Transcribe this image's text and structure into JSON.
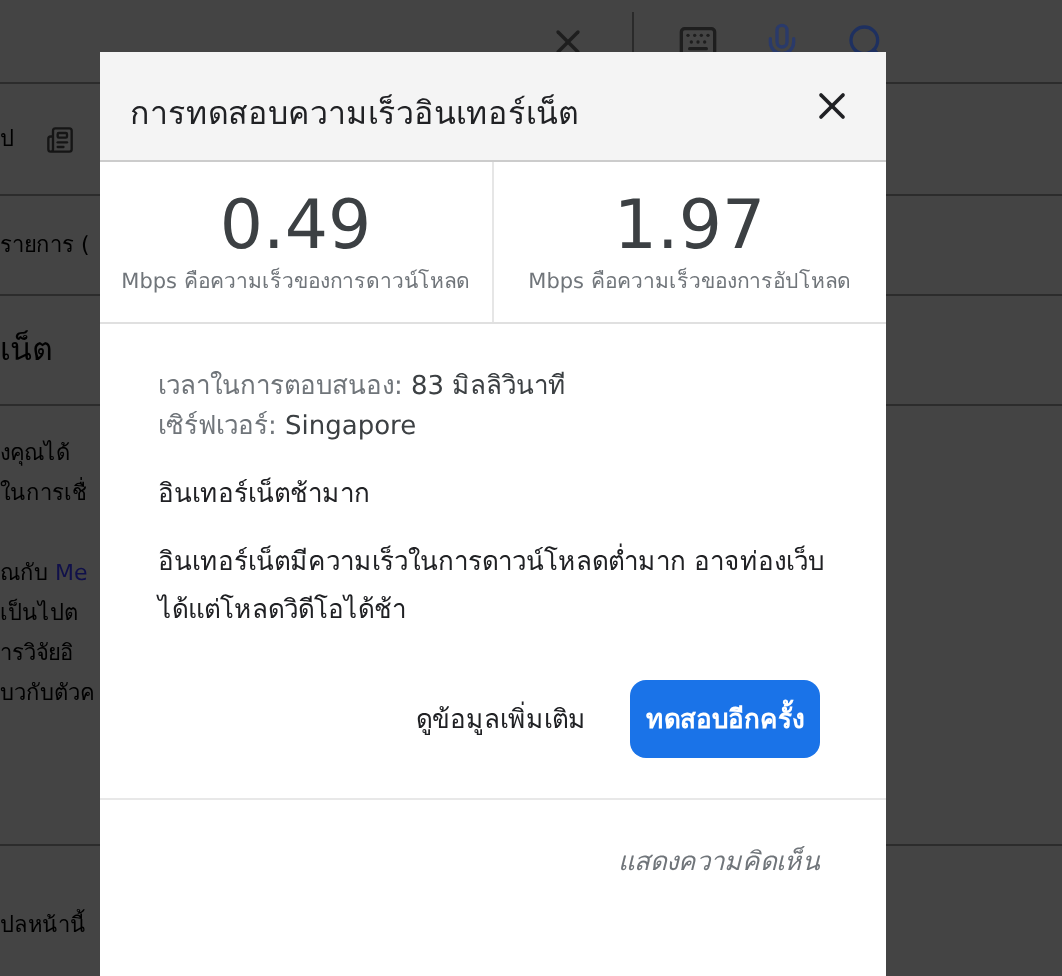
{
  "background": {
    "tab_fragment": "ป",
    "result_count": "รายการ (",
    "heading": "เน็ต",
    "paragraph_1": [
      "งคุณได้",
      "ในการเชื่"
    ],
    "paragraph_2": [
      {
        "text": "ณกับ ",
        "link": "Me"
      },
      {
        "text": "เป็นไปต"
      },
      {
        "text": "ารวิจัยอิ"
      },
      {
        "text": "บวกับตัวค"
      }
    ],
    "footer": "ปลหน้านี้"
  },
  "dialog": {
    "title": "การทดสอบความเร็วอินเทอร์เน็ต",
    "speeds": [
      {
        "value": "0.49",
        "label": "Mbps คือความเร็วของการดาวน์โหลด"
      },
      {
        "value": "1.97",
        "label": "Mbps คือความเร็วของการอัปโหลด"
      }
    ],
    "details": [
      {
        "label": "เวลาในการตอบสนอง:",
        "value": "83 มิลลิวินาที"
      },
      {
        "label": "เซิร์ฟเวอร์:",
        "value": "Singapore"
      }
    ],
    "verdict": "อินเทอร์เน็ตช้ามาก",
    "description": "อินเทอร์เน็ตมีความเร็วในการดาวน์โหลดต่ำมาก อาจท่องเว็บได้แต่โหลดวิดีโอได้ช้า",
    "more_button": "ดูข้อมูลเพิ่มเติม",
    "retry_button": "ทดสอบอีกครั้ง",
    "feedback_link": "แสดงความคิดเห็น"
  }
}
